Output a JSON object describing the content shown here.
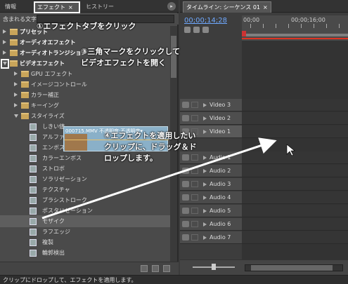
{
  "left_panel": {
    "tabs": [
      {
        "label": "情報"
      },
      {
        "label": "エフェクト",
        "close": "×"
      },
      {
        "label": "ヒストリー"
      }
    ],
    "menu_glyph": "▸",
    "search_label": "含まれる文字",
    "tree": [
      {
        "label": "プリセット",
        "kind": "folder",
        "level": 0,
        "state": "closed",
        "bold": true
      },
      {
        "label": "オーディオエフェクト",
        "kind": "folder",
        "level": 0,
        "state": "closed",
        "bold": true
      },
      {
        "label": "オーディオトランジション",
        "kind": "folder",
        "level": 0,
        "state": "closed",
        "bold": true
      },
      {
        "label": "ビデオエフェクト",
        "kind": "folder",
        "level": 0,
        "state": "open",
        "bold": true
      },
      {
        "label": "GPU エフェクト",
        "kind": "folder",
        "level": 1,
        "state": "closed"
      },
      {
        "label": "イメージコントロール",
        "kind": "folder",
        "level": 1,
        "state": "closed"
      },
      {
        "label": "カラー補正",
        "kind": "folder",
        "level": 1,
        "state": "closed"
      },
      {
        "label": "キーイング",
        "kind": "folder",
        "level": 1,
        "state": "closed"
      },
      {
        "label": "スタイライズ",
        "kind": "folder",
        "level": 1,
        "state": "open"
      },
      {
        "label": "しきい値",
        "kind": "effect",
        "level": 2
      },
      {
        "label": "アルファグロー",
        "kind": "effect",
        "level": 2
      },
      {
        "label": "エンボス",
        "kind": "effect",
        "level": 2
      },
      {
        "label": "カラーエンボス",
        "kind": "effect",
        "level": 2
      },
      {
        "label": "ストロボ",
        "kind": "effect",
        "level": 2
      },
      {
        "label": "ソラリゼーション",
        "kind": "effect",
        "level": 2
      },
      {
        "label": "テクスチャ",
        "kind": "effect",
        "level": 2
      },
      {
        "label": "ブラシストローク",
        "kind": "effect",
        "level": 2
      },
      {
        "label": "ポスタリゼーション",
        "kind": "effect",
        "level": 2
      },
      {
        "label": "モザイク",
        "kind": "effect",
        "level": 2,
        "selected": true
      },
      {
        "label": "ラフエッジ",
        "kind": "effect",
        "level": 2
      },
      {
        "label": "複製",
        "kind": "effect",
        "level": 2
      },
      {
        "label": "輪郭検出",
        "kind": "effect",
        "level": 2
      }
    ]
  },
  "right_panel": {
    "tab_label": "タイムライン: シーケンス 01",
    "tab_close": "×",
    "timecode": "00;00;14;28",
    "ruler_labels": [
      "00;00",
      "00;00;16;00"
    ],
    "playhead_fraction": 0.0,
    "clip_title": "000715.MMV 不透明度:不透明度▾",
    "video_tracks": [
      "Video 3",
      "Video 2",
      "Video 1"
    ],
    "audio_tracks": [
      "Audio 1",
      "Audio 2",
      "Audio 3",
      "Audio 4",
      "Audio 5",
      "Audio 6",
      "Audio 7"
    ],
    "zoom_level": 0.5
  },
  "status_bar": "クリップにドロップして、エフェクトを適用します。",
  "annotations": {
    "note1": "①エフェクトタブをクリック",
    "note3a": "③三角マークをクリックして",
    "note3b": "ビデオエフェクトを開く",
    "note4a": "④エフェクトを適用したい",
    "note4b": "クリップに、ドラッグ＆ド",
    "note4c": "ロップします。"
  },
  "colors": {
    "panel_bg": "#4a4a4a",
    "timecode": "#6fa9ff",
    "clip": "#8ab0c8",
    "playhead": "#dd3322"
  }
}
